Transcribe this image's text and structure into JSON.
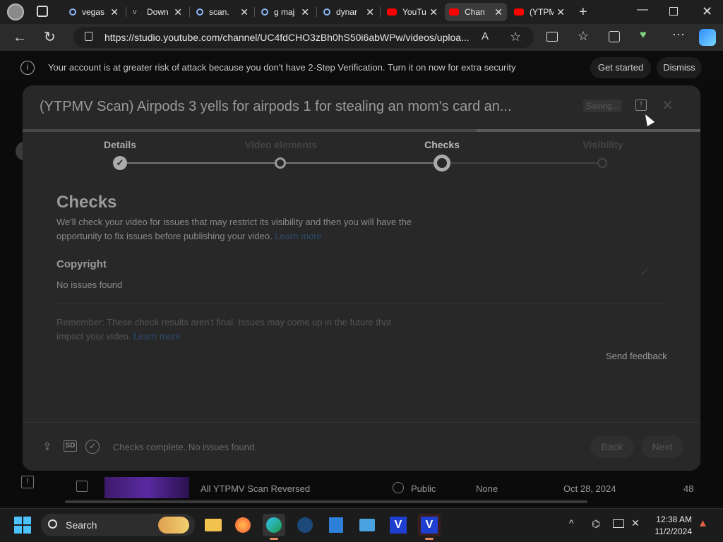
{
  "browser": {
    "tabs": [
      {
        "label": "vegas",
        "icon": "search-icon"
      },
      {
        "label": "Down",
        "icon": "v-icon"
      },
      {
        "label": "scan.",
        "icon": "search-icon"
      },
      {
        "label": "g maj",
        "icon": "search-icon"
      },
      {
        "label": "dynar",
        "icon": "search-icon"
      },
      {
        "label": "YouTu",
        "icon": "youtube-icon"
      },
      {
        "label": "Chan",
        "icon": "youtube-icon"
      },
      {
        "label": "(YTPM",
        "icon": "youtube-icon"
      }
    ],
    "url": "https://studio.youtube.com/channel/UC4fdCHO3zBh0hS50i6abWPw/videos/uploa...",
    "colors": {
      "accent": "#1a73e8",
      "youtube_red": "#ff0000"
    }
  },
  "banner": {
    "message": "Your account is at greater risk of attack because you don't have 2-Step Verification. Turn it on now for extra security",
    "get_started": "Get started",
    "dismiss": "Dismiss"
  },
  "dialog": {
    "title": "(YTPMV Scan) Airpods 3 yells for airpods 1 for stealing an mom's card an...",
    "saving": "Saving...",
    "steps": [
      "Details",
      "Video elements",
      "Checks",
      "Visibility"
    ],
    "progress": 0.67,
    "checks": {
      "heading": "Checks",
      "description": "We'll check your video for issues that may restrict its visibility and then you will have the opportunity to fix issues before publishing your video.",
      "learn_more": "Learn more",
      "copyright_heading": "Copyright",
      "copyright_status": "No issues found",
      "remember": "Remember: These check results aren't final. Issues may come up in the future that impact your video.",
      "learn_more2": "Learn more",
      "send_feedback": "Send feedback"
    },
    "footer": {
      "sd_badge": "SD",
      "status": "Checks complete. No issues found.",
      "back": "Back",
      "next": "Next"
    }
  },
  "video_row": {
    "title": "All YTPMV Scan Reversed",
    "visibility": "Public",
    "restrictions": "None",
    "date": "Oct 28, 2024",
    "views": "48"
  },
  "taskbar": {
    "search": "Search",
    "time": "12:38 AM",
    "date": "11/2/2024"
  }
}
